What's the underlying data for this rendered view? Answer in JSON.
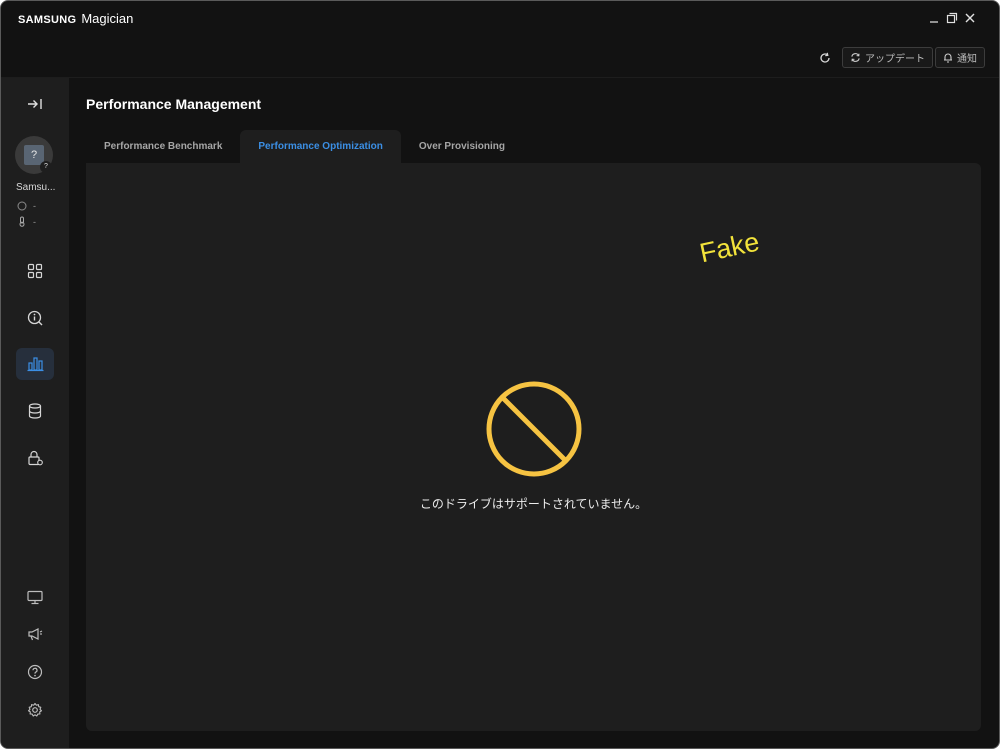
{
  "app": {
    "brand": "SAMSUNG",
    "product": "Magician"
  },
  "window_controls": {
    "minimize_icon": "minimize-icon",
    "restore_icon": "restore-icon",
    "close_icon": "close-icon"
  },
  "toolbar": {
    "refresh_icon": "refresh-icon",
    "update_label": "アップデート",
    "notify_label": "通知"
  },
  "sidebar": {
    "collapse_icon": "expand-sidebar-icon",
    "drive": {
      "name": "Samsu...",
      "health_value": "-",
      "temperature_value": "-"
    },
    "nav": [
      {
        "name": "dashboard",
        "icon": "grid-icon",
        "active": false
      },
      {
        "name": "diagnostics",
        "icon": "scan-icon",
        "active": false
      },
      {
        "name": "performance",
        "icon": "bar-chart-icon",
        "active": true
      },
      {
        "name": "data-management",
        "icon": "database-icon",
        "active": false
      },
      {
        "name": "security",
        "icon": "lock-icon",
        "active": false
      }
    ],
    "bottom": [
      {
        "name": "system-info",
        "icon": "monitor-icon"
      },
      {
        "name": "announcements",
        "icon": "megaphone-icon"
      },
      {
        "name": "help",
        "icon": "help-icon"
      },
      {
        "name": "settings",
        "icon": "gear-icon"
      }
    ]
  },
  "page": {
    "title": "Performance Management",
    "tabs": [
      {
        "label": "Performance Benchmark",
        "active": false
      },
      {
        "label": "Performance Optimization",
        "active": true
      },
      {
        "label": "Over Provisioning",
        "active": false
      }
    ],
    "watermark": "Fake",
    "status_icon": "unsupported-icon",
    "message": "このドライブはサポートされていません。"
  },
  "colors": {
    "accent": "#3b8fe5",
    "warning": "#f6c342",
    "watermark": "#f2e33b",
    "background": "#121212",
    "panel": "#1e1e1e"
  }
}
